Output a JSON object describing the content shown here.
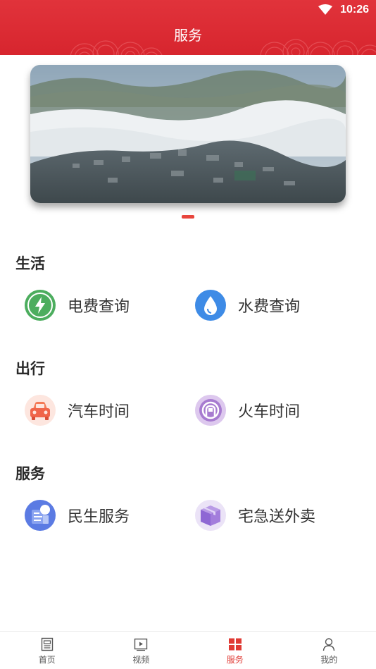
{
  "status_bar": {
    "time": "10:26"
  },
  "header": {
    "title": "服务"
  },
  "banner": {
    "pages": 1,
    "active_page": 1
  },
  "sections": [
    {
      "title": "生活",
      "items": [
        {
          "label": "电费查询",
          "icon": "lightning-icon"
        },
        {
          "label": "水费查询",
          "icon": "water-drop-icon"
        }
      ]
    },
    {
      "title": "出行",
      "items": [
        {
          "label": "汽车时间",
          "icon": "car-icon"
        },
        {
          "label": "火车时间",
          "icon": "train-icon"
        }
      ]
    },
    {
      "title": "服务",
      "items": [
        {
          "label": "民生服务",
          "icon": "document-icon"
        },
        {
          "label": "宅急送外卖",
          "icon": "package-icon"
        }
      ]
    }
  ],
  "tabbar": [
    {
      "label": "首页",
      "icon": "home-doc-icon",
      "active": false
    },
    {
      "label": "视频",
      "icon": "video-icon",
      "active": false
    },
    {
      "label": "服务",
      "icon": "grid-icon",
      "active": true
    },
    {
      "label": "我的",
      "icon": "user-icon",
      "active": false
    }
  ],
  "colors": {
    "brand_red": "#d7252e",
    "active_tab": "#e03a34"
  }
}
